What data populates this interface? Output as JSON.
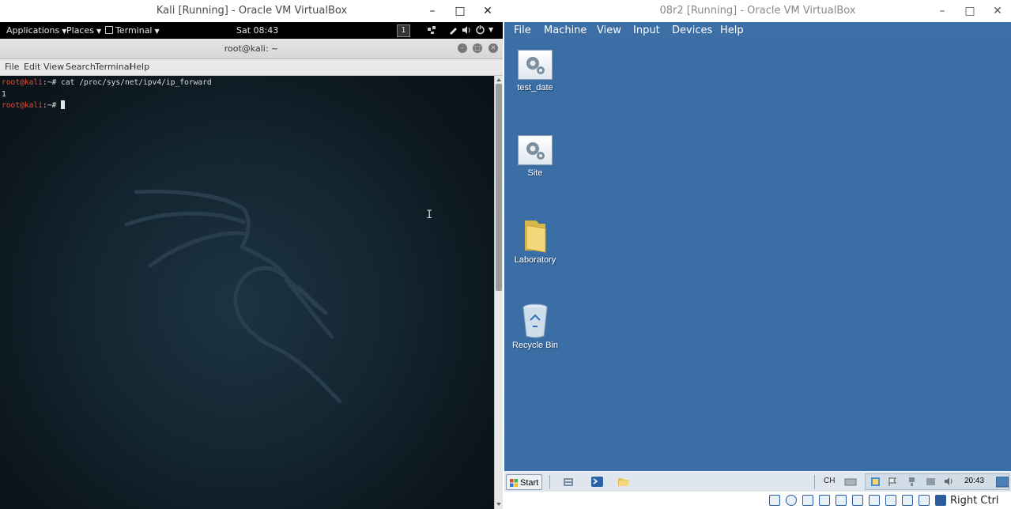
{
  "left_window": {
    "title": "Kali [Running] - Oracle VM VirtualBox",
    "gnome_panel": {
      "applications": "Applications",
      "places": "Places",
      "terminal": "Terminal",
      "clock": "Sat 08:43",
      "workspace": "1"
    },
    "terminal": {
      "title": "root@kali: ~",
      "menu": [
        "File",
        "Edit",
        "View",
        "Search",
        "Terminal",
        "Help"
      ],
      "lines": [
        {
          "prompt": "root@kali",
          "rest": ":~# cat /proc/sys/net/ipv4/ip_forward"
        },
        {
          "output": "1"
        },
        {
          "prompt": "root@kali",
          "rest": ":~# "
        }
      ]
    }
  },
  "right_window": {
    "title": "08r2 [Running] - Oracle VM VirtualBox",
    "menu": [
      "File",
      "Machine",
      "View",
      "Input",
      "Devices",
      "Help"
    ],
    "desktop_icons": [
      "test_date",
      "Site",
      "Laboratory",
      "Recycle Bin"
    ],
    "taskbar": {
      "start": "Start",
      "language": "CH",
      "clock": "20:43"
    },
    "host_key": "Right Ctrl"
  },
  "colors": {
    "win_desktop": "#3b6ea5",
    "kali_prompt": "#e0513a",
    "terminal_bg": "#0f1a22"
  }
}
